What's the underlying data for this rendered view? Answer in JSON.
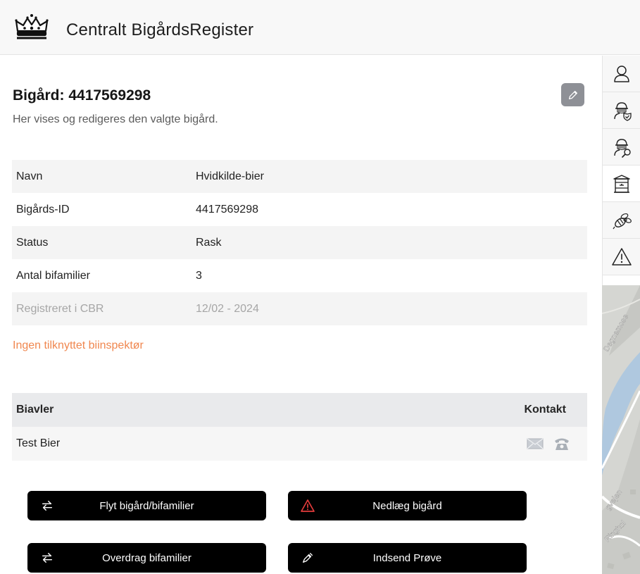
{
  "header": {
    "title": "Centralt BigårdsRegister"
  },
  "page": {
    "title": "Bigård: 4417569298",
    "subtitle": "Her vises og redigeres den valgte bigård."
  },
  "details": [
    {
      "label": "Navn",
      "value": "Hvidkilde-bier"
    },
    {
      "label": "Bigårds-ID",
      "value": "4417569298"
    },
    {
      "label": "Status",
      "value": "Rask"
    },
    {
      "label": "Antal bifamilier",
      "value": "3"
    },
    {
      "label": "Registreret i CBR",
      "value": "12/02 - 2024"
    }
  ],
  "inspector_notice": "Ingen tilknyttet biinspektør",
  "beekeepers": {
    "headers": {
      "name": "Biavler",
      "contact": "Kontakt"
    },
    "rows": [
      {
        "name": "Test Bier"
      }
    ]
  },
  "actions": {
    "move": "Flyt bigård/bifamilier",
    "close": "Nedlæg bigård",
    "transfer": "Overdrag bifamilier",
    "sample": "Indsend Prøve"
  },
  "map_labels": [
    "Degnemose",
    "gvejen",
    "Ringhol"
  ],
  "icons": {
    "logo": "crown-icon",
    "edit": "pencil-icon",
    "sidebar": [
      "user-icon",
      "beekeeper-shield-icon",
      "beekeeper-search-icon",
      "beehive-icon",
      "bee-icon",
      "warning-icon"
    ],
    "contact": [
      "mail-icon",
      "phone-icon"
    ],
    "actions": [
      "swap-arrows-icon",
      "warning-icon",
      "swap-arrows-icon",
      "pipette-icon"
    ]
  },
  "colors": {
    "notice": "#f0874f",
    "danger_icon": "#e33b3b",
    "button": "#000000"
  }
}
